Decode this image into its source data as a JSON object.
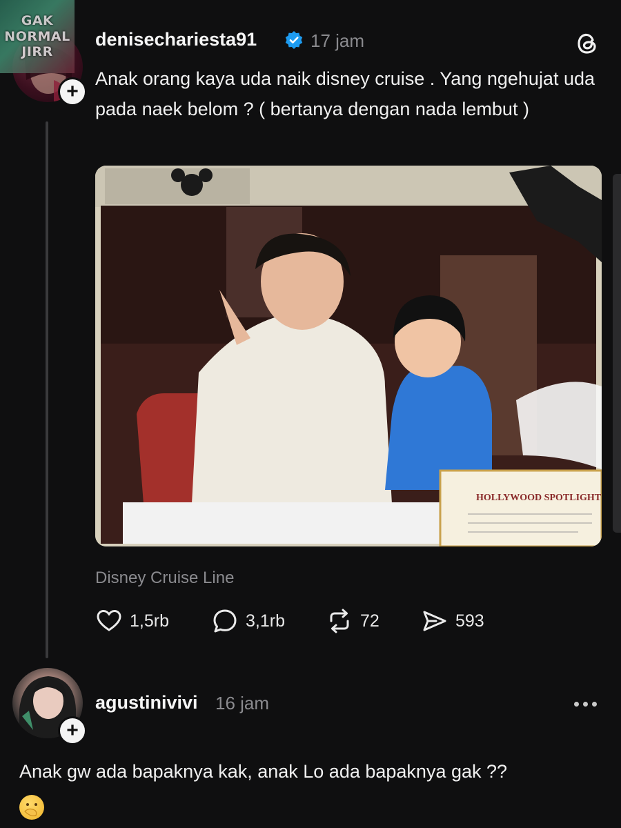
{
  "watermark": {
    "line1": "GAK",
    "line2": "NORMAL",
    "line3": "JIRR"
  },
  "post": {
    "username": "denisechariesta91",
    "time": "17 jam",
    "text": "Anak orang kaya uda naik disney cruise . Yang ngehujat uda pada naek belom ? ( bertanya dengan nada lembut )",
    "location": "Disney Cruise Line",
    "photo_texts": {
      "certificate_title": "HOLLYWOOD SPOTLIGHT C"
    },
    "stats": {
      "likes": "1,5rb",
      "replies": "3,1rb",
      "reposts": "72",
      "shares": "593"
    }
  },
  "comment": {
    "username": "agustinivivi",
    "time": "16 jam",
    "text": "Anak gw ada bapaknya kak, anak Lo ada bapaknya gak ??",
    "emoji": "🤭"
  },
  "icons": [
    "threads-logo-icon",
    "verified-badge-icon",
    "follow-plus-icon",
    "heart-icon",
    "reply-bubble-icon",
    "repost-icon",
    "share-send-icon",
    "more-options-icon"
  ],
  "colors": {
    "background": "#0f0f10",
    "verified": "#1d9bf0",
    "muted_text": "#8a8a8e"
  }
}
